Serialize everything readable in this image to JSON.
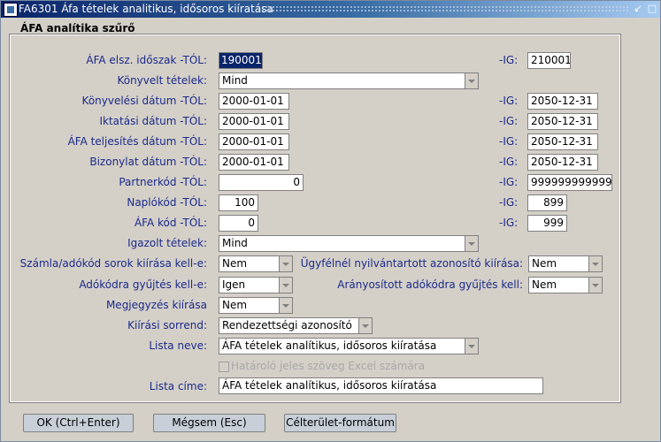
{
  "window": {
    "title": "FA6301 Áfa tételek analitikus, idősoros kiíratása"
  },
  "group_title": "ÁFA analítika szűrő",
  "rows": {
    "afa_elsz": {
      "label": "ÁFA elsz. időszak -TÓL:",
      "from": "190001",
      "to_label": "-IG:",
      "to": "210001"
    },
    "konyvelt": {
      "label": "Könyvelt tételek:",
      "value": "Mind"
    },
    "konyv_datum": {
      "label": "Könyvelési dátum -TÓL:",
      "from": "2000-01-01",
      "to_label": "-IG:",
      "to": "2050-12-31"
    },
    "iktat_datum": {
      "label": "Iktatási dátum -TÓL:",
      "from": "2000-01-01",
      "to_label": "-IG:",
      "to": "2050-12-31"
    },
    "telj_datum": {
      "label": "ÁFA teljesítés dátum -TÓL:",
      "from": "2000-01-01",
      "to_label": "-IG:",
      "to": "2050-12-31"
    },
    "biz_datum": {
      "label": "Bizonylat dátum -TÓL:",
      "from": "2000-01-01",
      "to_label": "-IG:",
      "to": "2050-12-31"
    },
    "partnerkod": {
      "label": "Partnerkód -TÓL:",
      "from": "0",
      "to_label": "-IG:",
      "to": "999999999999"
    },
    "naplokod": {
      "label": "Naplókód -TÓL:",
      "from": "100",
      "to_label": "-IG:",
      "to": "899"
    },
    "afakod": {
      "label": "ÁFA kód -TÓL:",
      "from": "0",
      "to_label": "-IG:",
      "to": "999"
    },
    "igazolt": {
      "label": "Igazolt tételek:",
      "value": "Mind"
    },
    "szamla_kiiras": {
      "label": "Számla/adókód sorok kiírása kell-e:",
      "value": "Nem"
    },
    "ugyfel_kiiras": {
      "label": "Ügyfélnél nyilvántartott azonosító kiírása:",
      "value": "Nem"
    },
    "adokod_gyujt": {
      "label": "Adókódra gyűjtés kell-e:",
      "value": "Igen"
    },
    "aranyositott": {
      "label": "Arányosított adókódra gyűjtés kell:",
      "value": "Nem"
    },
    "megjegyzes": {
      "label": "Megjegyzés kiírása",
      "value": "Nem"
    },
    "sorrend": {
      "label": "Kiírási sorrend:",
      "value": "Rendezettségi azonosító"
    },
    "lista_neve": {
      "label": "Lista neve:",
      "value": "ÁFA tételek analítikus, idősoros kiíratása"
    },
    "hatarolo": {
      "label": "Határoló jeles szöveg  Excel számára",
      "checked": false
    },
    "lista_cime": {
      "label": "Lista címe:",
      "value": "ÁFA tételek analítikus, idősoros kiíratása"
    }
  },
  "buttons": {
    "ok": "OK (Ctrl+Enter)",
    "cancel": "Mégsem (Esc)",
    "target": "Célterület-formátum"
  },
  "colors": {
    "title_bar": "#0a246a",
    "label": "#1b2a8a",
    "background": "#d4d0c8"
  }
}
